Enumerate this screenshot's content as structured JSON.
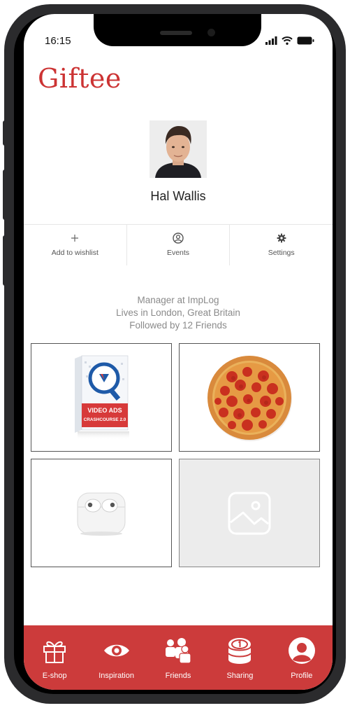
{
  "status_bar": {
    "time": "16:15"
  },
  "app": {
    "logo": "Giftee"
  },
  "profile": {
    "name": "Hal  Wallis",
    "bio": [
      "Manager at ImpLog",
      "Lives in London, Great Britain",
      "Followed by 12 Friends"
    ]
  },
  "actions": [
    {
      "label": "Add to wishlist",
      "icon": "plus-icon"
    },
    {
      "label": "Events",
      "icon": "user-circle-icon"
    },
    {
      "label": "Settings",
      "icon": "gear-icon"
    }
  ],
  "wishlist": {
    "items": [
      {
        "name": "video-ads-course-box",
        "box_title": "VIDEO ADS",
        "box_subtitle": "CRASHCOURSE 2.0"
      },
      {
        "name": "pepperoni-pizza"
      },
      {
        "name": "airpods"
      },
      {
        "name": "image-placeholder"
      }
    ]
  },
  "tabbar": {
    "items": [
      {
        "label": "E-shop",
        "icon": "gift-icon"
      },
      {
        "label": "Inspiration",
        "icon": "eye-icon"
      },
      {
        "label": "Friends",
        "icon": "group-icon"
      },
      {
        "label": "Sharing",
        "icon": "coin-stack-icon"
      },
      {
        "label": "Profile",
        "icon": "profile-icon"
      }
    ]
  },
  "colors": {
    "brand": "#cc3333",
    "tabbar": "#cc3b3b"
  }
}
